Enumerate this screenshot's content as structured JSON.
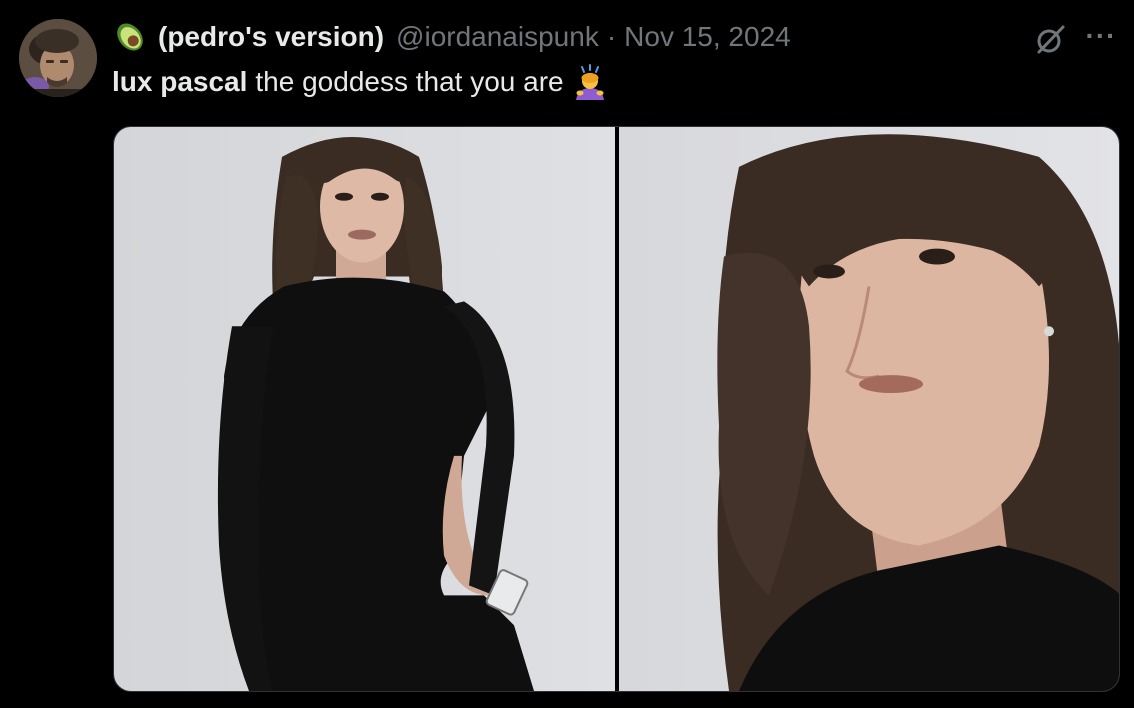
{
  "author": {
    "display_name": "(pedro's version)",
    "handle": "@iordanaispunk",
    "separator": "·",
    "timestamp": "Nov 15, 2024",
    "name_emoji": "avocado-icon"
  },
  "tweet": {
    "mention": "lux pascal",
    "text": "the goddess that you are",
    "emoji": "person-bowing-icon"
  },
  "actions": {
    "grok_icon": "grok-icon",
    "more_label": "···"
  },
  "media": {
    "count": 2,
    "photos": [
      "photo-full-length",
      "photo-close-up"
    ]
  },
  "colors": {
    "background": "#000000",
    "primary_text": "#e7e9ea",
    "secondary_text": "#71767b",
    "border": "#2f3336"
  }
}
